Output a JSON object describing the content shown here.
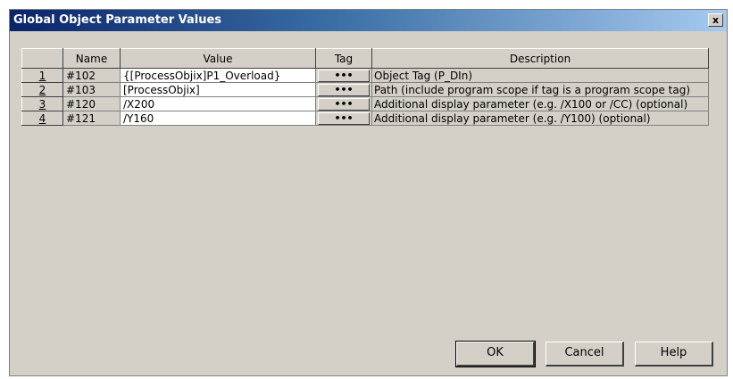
{
  "window": {
    "title": "Global Object Parameter Values",
    "close_label": "x"
  },
  "table": {
    "columns": [
      "",
      "Name",
      "Value",
      "Tag",
      "Description"
    ],
    "rows": [
      {
        "num": "1",
        "name": "#102",
        "value": "{[ProcessObjix]P1_Overload}",
        "tag": "•••",
        "description": "Object Tag (P_DIn)"
      },
      {
        "num": "2",
        "name": "#103",
        "value": "[ProcessObjix]",
        "tag": "•••",
        "description": "Path (include program scope if tag is a program scope tag)"
      },
      {
        "num": "3",
        "name": "#120",
        "value": "/X200",
        "tag": "•••",
        "description": "Additional display parameter (e.g. /X100 or /CC) (optional)"
      },
      {
        "num": "4",
        "name": "#121",
        "value": "/Y160",
        "tag": "•••",
        "description": "Additional display parameter (e.g. /Y100) (optional)"
      }
    ]
  },
  "buttons": {
    "ok": "OK",
    "cancel": "Cancel",
    "help": "Help"
  }
}
